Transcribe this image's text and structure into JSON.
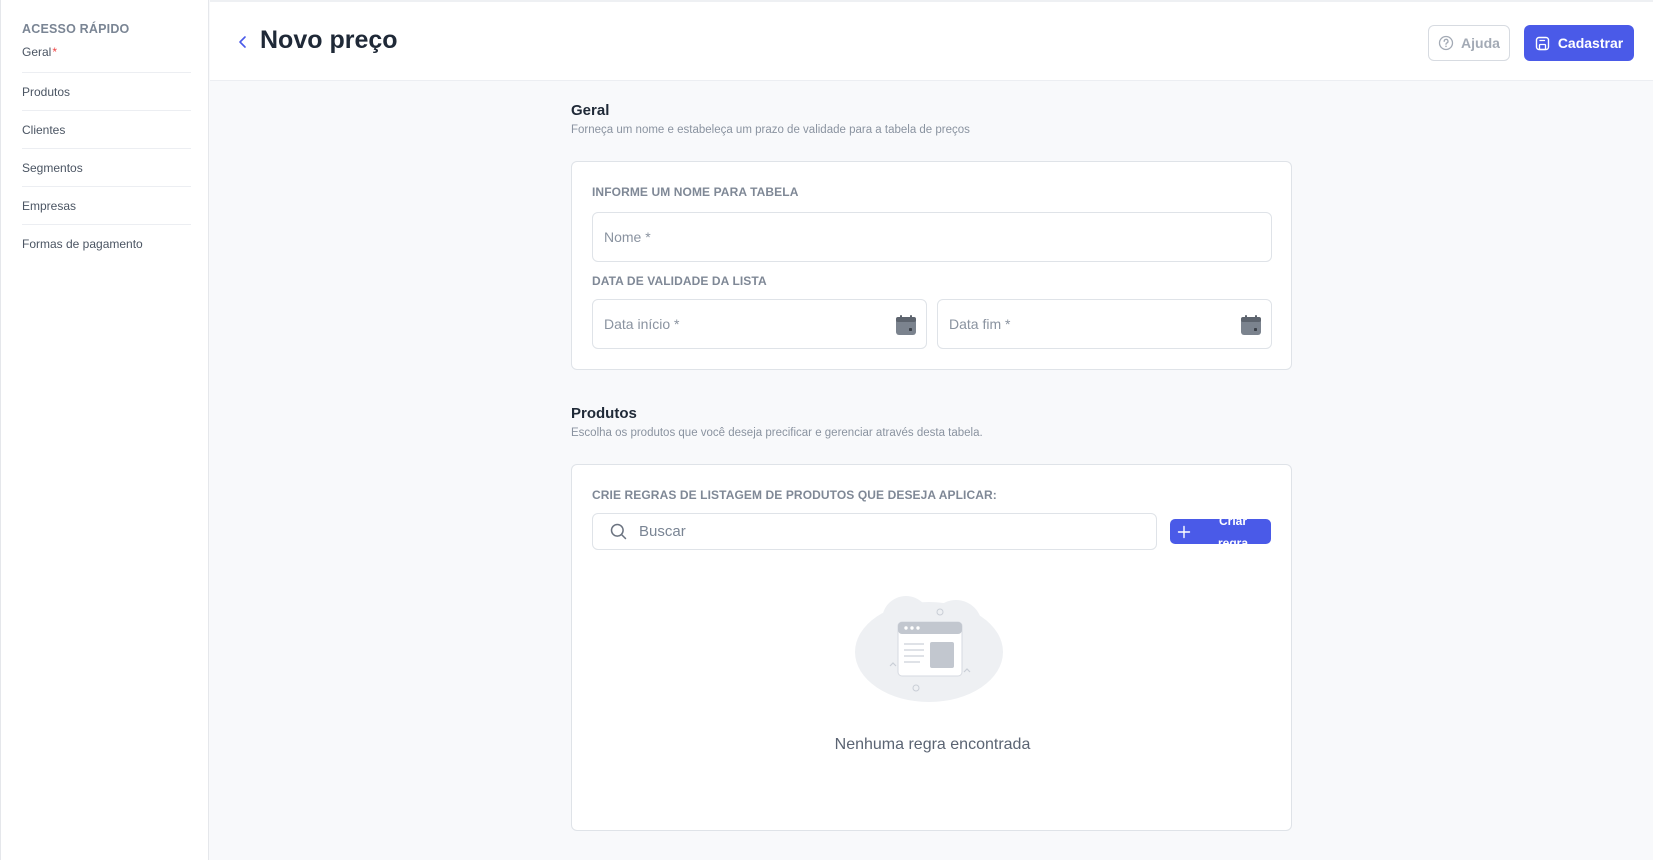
{
  "sidebar": {
    "heading": "ACESSO RÁPIDO",
    "items": [
      {
        "label": "Geral",
        "required_mark": "*"
      },
      {
        "label": "Produtos"
      },
      {
        "label": "Clientes"
      },
      {
        "label": "Segmentos"
      },
      {
        "label": "Empresas"
      },
      {
        "label": "Formas de pagamento"
      }
    ]
  },
  "header": {
    "title": "Novo preço",
    "help_label": "Ajuda",
    "submit_label": "Cadastrar"
  },
  "general": {
    "title": "Geral",
    "description": "Forneça um nome e estabeleça um prazo de validade para a tabela de preços",
    "name_label": "INFORME UM NOME PARA TABELA",
    "name_placeholder": "Nome *",
    "name_value": "",
    "validity_label": "DATA DE VALIDADE DA LISTA",
    "start_placeholder": "Data início *",
    "start_value": "",
    "end_placeholder": "Data fim *",
    "end_value": ""
  },
  "products": {
    "title": "Produtos",
    "description": "Escolha os produtos que você deseja precificar e gerenciar através desta tabela.",
    "rules_label": "CRIE REGRAS DE LISTAGEM DE PRODUTOS QUE DESEJA APLICAR:",
    "search_placeholder": "Buscar",
    "search_value": "",
    "add_rule_label": "Criar regra",
    "empty_message": "Nenhuma regra encontrada"
  },
  "icons": {
    "back": "chevron-left-icon",
    "help": "question-circle-icon",
    "submit": "save-icon",
    "calendar": "calendar-icon",
    "search": "search-icon",
    "add": "plus-icon",
    "empty": "empty-browser-illustration"
  },
  "colors": {
    "primary": "#4a5ae8",
    "required": "#ef4444",
    "background": "#f8f9fb"
  }
}
